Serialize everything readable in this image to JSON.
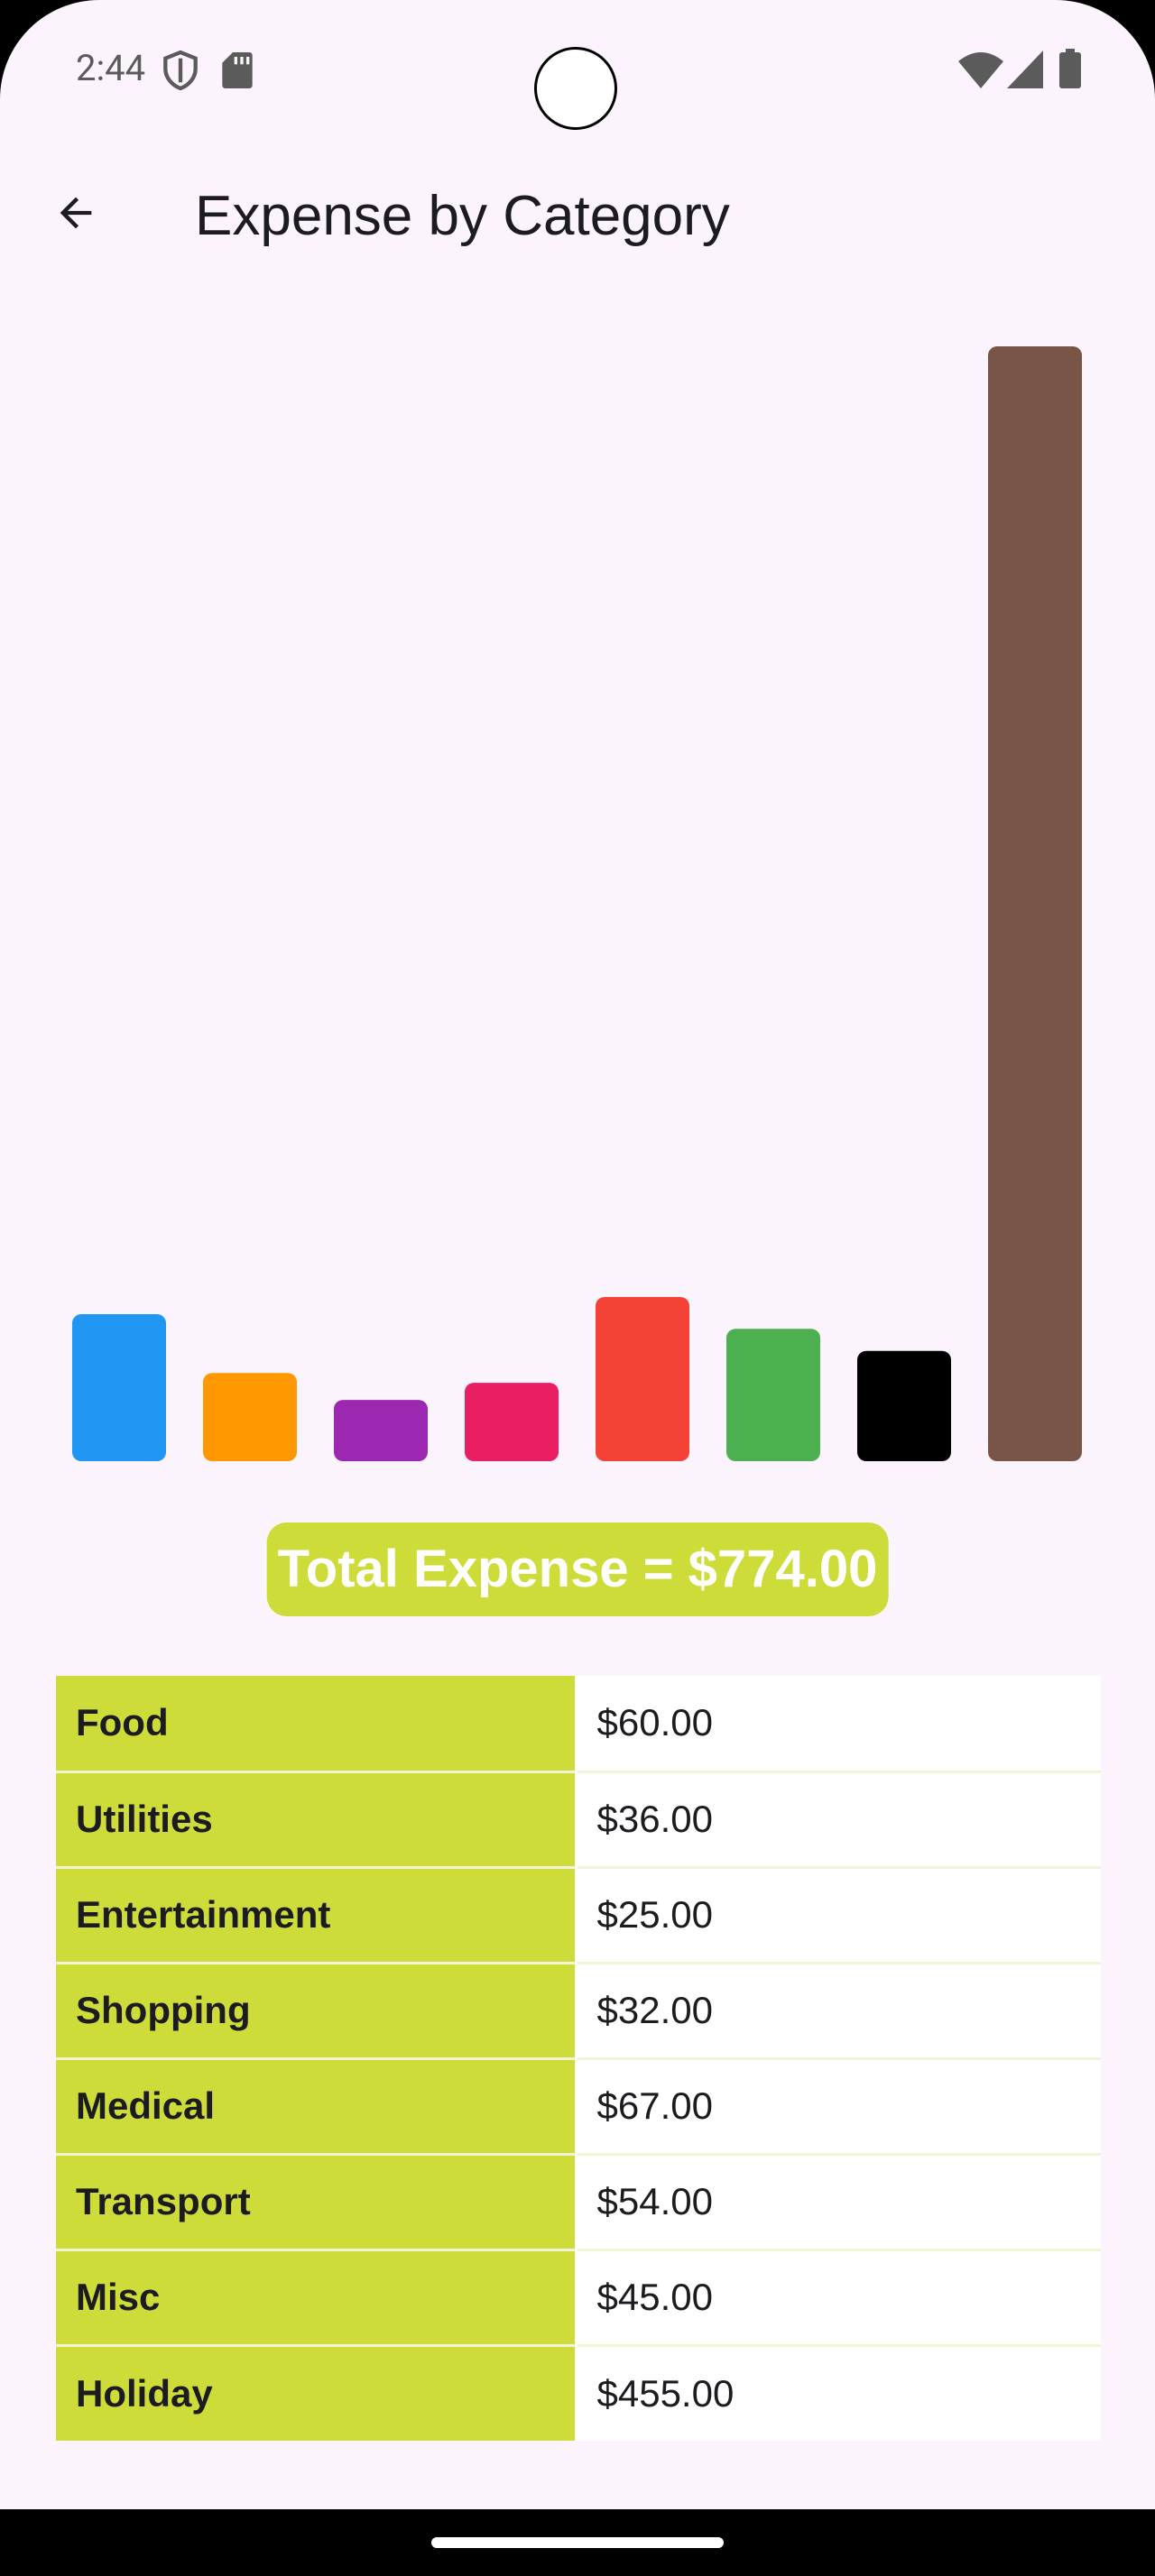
{
  "status_bar": {
    "time": "2:44",
    "icons": [
      "shield-icon",
      "sd-card-icon",
      "wifi-icon",
      "signal-icon",
      "battery-icon"
    ]
  },
  "app_bar": {
    "title": "Expense by Category",
    "back_icon": "arrow-back-icon"
  },
  "chart_data": {
    "type": "bar",
    "categories": [
      "Food",
      "Utilities",
      "Entertainment",
      "Shopping",
      "Medical",
      "Transport",
      "Misc",
      "Holiday"
    ],
    "values": [
      60,
      36,
      25,
      32,
      67,
      54,
      45,
      455
    ],
    "colors": [
      "#2196f3",
      "#ff9800",
      "#9c27b0",
      "#e91e63",
      "#f44336",
      "#4caf50",
      "#000000",
      "#795548"
    ],
    "title": "",
    "xlabel": "",
    "ylabel": "",
    "grid": false
  },
  "total": {
    "label": "Total Expense = $774.00"
  },
  "table": {
    "rows": [
      {
        "category": "Food",
        "amount": "$60.00"
      },
      {
        "category": "Utilities",
        "amount": "$36.00"
      },
      {
        "category": "Entertainment",
        "amount": "$25.00"
      },
      {
        "category": "Shopping",
        "amount": "$32.00"
      },
      {
        "category": "Medical",
        "amount": "$67.00"
      },
      {
        "category": "Transport",
        "amount": "$54.00"
      },
      {
        "category": "Misc",
        "amount": "$45.00"
      },
      {
        "category": "Holiday",
        "amount": "$455.00"
      }
    ]
  },
  "colors": {
    "background": "#fcf4fc",
    "accent": "#cddc39"
  }
}
